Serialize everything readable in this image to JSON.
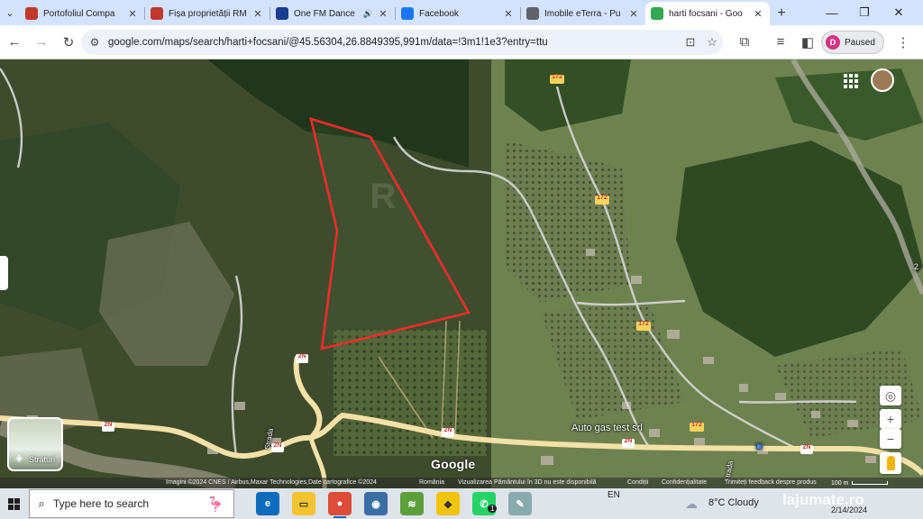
{
  "browser": {
    "tabs": [
      {
        "title": "Portofoliul Compa",
        "icon": "realestate-icon",
        "color": "#c0392b",
        "active": false
      },
      {
        "title": "Fișa proprietății RM",
        "icon": "realestate-icon",
        "color": "#c0392b",
        "active": false
      },
      {
        "title": "One FM Dance",
        "icon": "radio-icon",
        "color": "#1a3d8f",
        "active": false,
        "audio": "🔊"
      },
      {
        "title": "Facebook",
        "icon": "facebook-icon",
        "color": "#1877f2",
        "active": false
      },
      {
        "title": "Imobile eTerra - Pu",
        "icon": "globe-icon",
        "color": "#5f6368",
        "active": false
      },
      {
        "title": "harti focsani - Goo",
        "icon": "maps-pin-icon",
        "color": "#34a853",
        "active": true
      }
    ],
    "new_tab": "+",
    "url": "google.com/maps/search/harti+focsani/@45.56304,26.8849395,991m/data=!3m1!1e3?entry=ttu",
    "profile": {
      "initial": "D",
      "status": "Paused"
    }
  },
  "map": {
    "route_labels": [
      "172",
      "172",
      "172",
      "172",
      "2N",
      "2N",
      "2N",
      "2N",
      "2N",
      "2N"
    ],
    "place_label": "Auto gas test srl",
    "street_labels": [
      "Strada",
      "Strada"
    ],
    "layers_label": "Straturi",
    "google_logo": "Google",
    "attribution": {
      "imagery": "Imagini ©2024 CNES / Airbus,Maxar Technologies,Date cartografice ©2024",
      "country": "România",
      "view3d": "Vizualizarea Pământului în 3D nu este disponibilă",
      "terms": "Condiții",
      "privacy": "Confidențialitate",
      "feedback": "Trimiteți feedback despre produs",
      "scale": "100 m"
    },
    "controls": {
      "locate": "◎",
      "zoom_in": "+",
      "zoom_out": "−"
    },
    "side_label": "2"
  },
  "taskbar": {
    "search_placeholder": "Type here to search",
    "lang": "EN",
    "weather": "8°C  Cloudy",
    "date": "2/14/2024",
    "badge": "1"
  },
  "watermark": "lajumate.ro",
  "colors": {
    "parcel_outline": "#ff2a2a",
    "road": "#f3e1a8",
    "track": "#d9d9d9"
  }
}
